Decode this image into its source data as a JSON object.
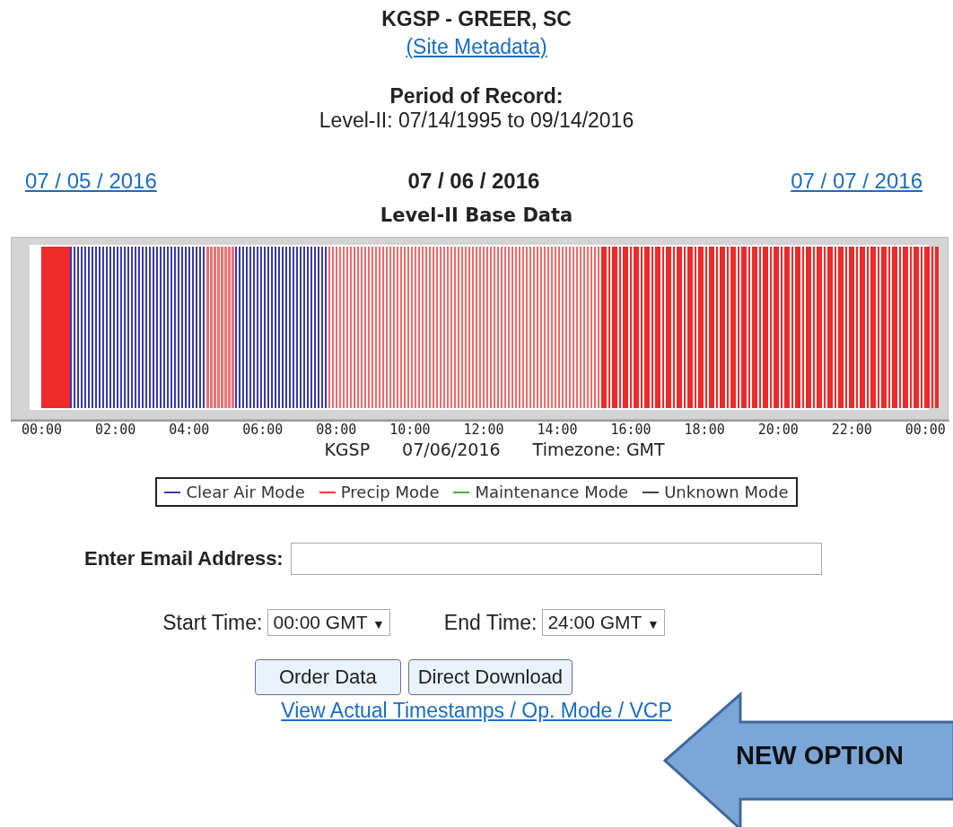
{
  "site": {
    "title": "KGSP - GREER, SC",
    "metadata_link": "(Site Metadata)"
  },
  "period": {
    "heading": "Period of Record:",
    "text": "Level-II: 07/14/1995 to 09/14/2016"
  },
  "dates": {
    "previous": "07 / 05 / 2016",
    "current": "07 / 06 / 2016",
    "next": "07 / 07 / 2016"
  },
  "chart": {
    "title": "Level-II Base Data",
    "xticks": [
      "00:00",
      "02:00",
      "04:00",
      "06:00",
      "08:00",
      "10:00",
      "12:00",
      "14:00",
      "16:00",
      "18:00",
      "20:00",
      "22:00",
      "00:00"
    ],
    "caption_station": "KGSP",
    "caption_date": "07/06/2016",
    "caption_timezone": "Timezone: GMT",
    "legend": [
      {
        "label": "Clear Air Mode",
        "color": "#3a3aa8"
      },
      {
        "label": "Precip Mode",
        "color": "#f03a3a"
      },
      {
        "label": "Maintenance Mode",
        "color": "#3cb33c"
      },
      {
        "label": "Unknown Mode",
        "color": "#444444"
      }
    ]
  },
  "form": {
    "email_label": "Enter Email Address:",
    "start_label": "Start Time:",
    "start_value": "00:00 GMT",
    "end_label": "End Time:",
    "end_value": "24:00 GMT",
    "dropdown_caret": "▼",
    "buttons": [
      "Order Data",
      "Direct Download"
    ],
    "timestamps_link": "View Actual Timestamps / Op. Mode / VCP"
  },
  "callout": {
    "label": "NEW OPTION"
  }
}
